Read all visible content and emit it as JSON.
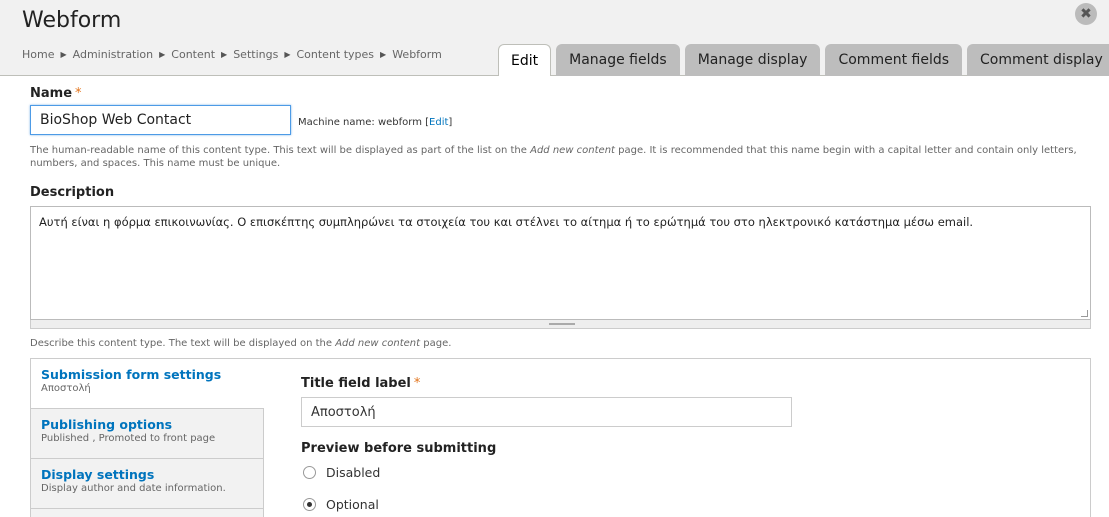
{
  "header": {
    "title": "Webform",
    "close_label": "✖",
    "breadcrumb": [
      "Home",
      "Administration",
      "Content",
      "Settings",
      "Content types",
      "Webform"
    ],
    "breadcrumb_sep": "▶"
  },
  "tabs": [
    {
      "label": "Edit",
      "active": true
    },
    {
      "label": "Manage fields",
      "active": false
    },
    {
      "label": "Manage display",
      "active": false
    },
    {
      "label": "Comment fields",
      "active": false
    },
    {
      "label": "Comment display",
      "active": false
    }
  ],
  "name_field": {
    "label": "Name",
    "required_mark": "*",
    "value": "BioShop Web Contact",
    "machine_prefix": "Machine name: webform",
    "machine_edit": "Edit",
    "help_1": "The human-readable name of this content type. This text will be displayed as part of the list on the ",
    "help_em": "Add new content",
    "help_2": " page. It is recommended that this name begin with a capital letter and contain only letters, numbers, and spaces. This name must be unique."
  },
  "description_field": {
    "label": "Description",
    "value": "Αυτή είναι η φόρμα επικοινωνίας. Ο επισκέπτης συμπληρώνει τα στοιχεία του και στέλνει το αίτημα ή το ερώτημά του στο ηλεκτρονικό κατάστημα μέσω email.",
    "help_1": "Describe this content type. The text will be displayed on the ",
    "help_em": "Add new content",
    "help_2": " page."
  },
  "vertical_tabs": [
    {
      "title": "Submission form settings",
      "summary": "Αποστολή",
      "active": true
    },
    {
      "title": "Publishing options",
      "summary": "Published , Promoted to front page",
      "active": false
    },
    {
      "title": "Display settings",
      "summary": "Display author and date information.",
      "active": false
    }
  ],
  "submission_pane": {
    "title_label": "Title field label",
    "required_mark": "*",
    "title_value": "Αποστολή",
    "preview_label": "Preview before submitting",
    "options": [
      {
        "label": "Disabled",
        "checked": false
      },
      {
        "label": "Optional",
        "checked": true
      }
    ]
  },
  "colors": {
    "accent": "#0074bd",
    "required": "#e2741c",
    "focus": "#4d9be6"
  }
}
